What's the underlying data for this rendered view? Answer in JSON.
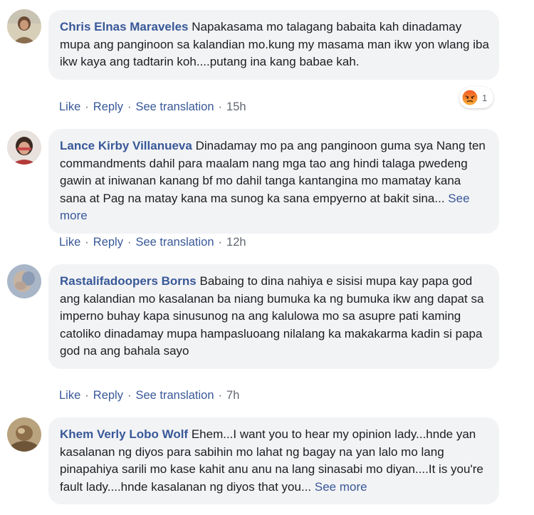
{
  "labels": {
    "like": "Like",
    "reply": "Reply",
    "see_translation": "See translation",
    "separator": "·",
    "see_more": "See more"
  },
  "comments": [
    {
      "author": "Chris Elnas Maraveles",
      "text": "Napakasama mo talagang babaita kah dinadamay mupa ang panginoon sa kalandian mo.kung my masama man ikw yon wlang iba ikw kaya ang tadtarin koh....putang ina kang babae kah.",
      "time": "15h",
      "reaction": {
        "icon": "angry-reaction-icon",
        "count": "1"
      }
    },
    {
      "author": "Lance Kirby Villanueva",
      "text": "Dinadamay mo pa ang panginoon guma sya Nang ten commandments dahil para maalam nang mga tao ang hindi talaga pwedeng gawin at iniwanan kanang bf mo dahil tanga kantangina mo mamatay kana sana at Pag na matay kana ma sunog ka sana empyerno at bakit sina...",
      "time": "12h"
    },
    {
      "author": "Rastalifadoopers Borns",
      "text": "Babaing to dina nahiya e sisisi mupa kay papa god ang kalandian mo kasalanan ba niang bumuka ka ng bumuka ikw ang dapat sa imperno buhay kapa sinusunog na ang kalulowa mo sa asupre pati kaming catoliko dinadamay mupa hampasluoang nilalang ka makakarma kadin si papa god na ang bahala sayo",
      "time": "7h"
    },
    {
      "author": "Khem Verly Lobo Wolf",
      "text": "Ehem...I want you to hear my opinion lady...hnde yan kasalanan ng diyos para sabihin mo lahat ng bagay na yan lalo mo lang pinapahiya sarili mo kase kahit anu anu na lang sinasabi mo diyan....It is you're fault lady....hnde kasalanan ng diyos that you..."
    }
  ],
  "colors": {
    "link": "#385898",
    "meta": "#606770",
    "bubble": "#f2f3f5",
    "angry": "#e9710f"
  }
}
